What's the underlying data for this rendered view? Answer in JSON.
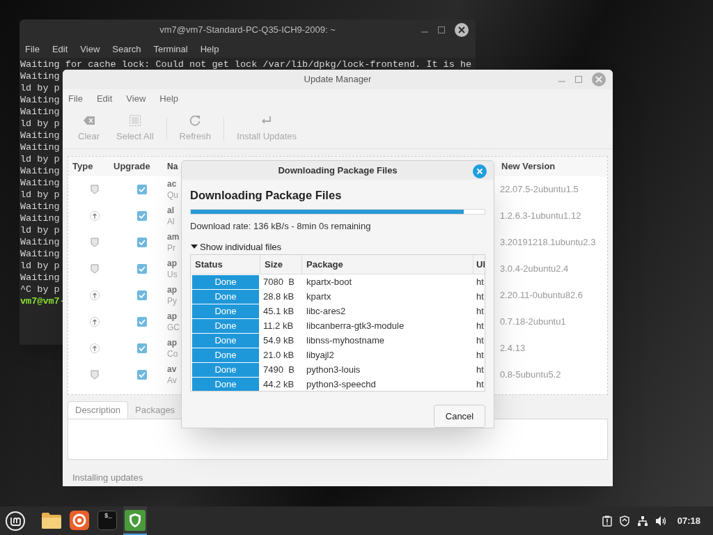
{
  "terminal": {
    "title": "vm7@vm7-Standard-PC-Q35-ICH9-2009: ~",
    "menu": [
      "File",
      "Edit",
      "View",
      "Search",
      "Terminal",
      "Help"
    ],
    "lines": [
      {
        "kind": "output",
        "text": "Waiting for cache lock: Could not get lock /var/lib/dpkg/lock-frontend. It is he"
      },
      {
        "kind": "output",
        "text": "Waiting"
      },
      {
        "kind": "output",
        "text": "ld by p"
      },
      {
        "kind": "output",
        "text": "Waiting"
      },
      {
        "kind": "output",
        "text": "Waiting"
      },
      {
        "kind": "output",
        "text": "ld by p"
      },
      {
        "kind": "output",
        "text": "Waiting"
      },
      {
        "kind": "output",
        "text": "Waiting"
      },
      {
        "kind": "output",
        "text": "ld by p"
      },
      {
        "kind": "output",
        "text": "Waiting"
      },
      {
        "kind": "output",
        "text": "Waiting"
      },
      {
        "kind": "output",
        "text": "ld by p"
      },
      {
        "kind": "output",
        "text": "Waiting"
      },
      {
        "kind": "output",
        "text": "Waiting"
      },
      {
        "kind": "output",
        "text": "ld by p"
      },
      {
        "kind": "output",
        "text": "Waiting"
      },
      {
        "kind": "output",
        "text": "Waiting"
      },
      {
        "kind": "output",
        "text": "ld by p"
      },
      {
        "kind": "output",
        "text": "Waiting"
      },
      {
        "kind": "output",
        "text": "^C by p"
      },
      {
        "kind": "prompt",
        "text": "vm7@vm7-"
      }
    ]
  },
  "update_manager": {
    "title": "Update Manager",
    "menu": [
      "File",
      "Edit",
      "View",
      "Help"
    ],
    "toolbar": [
      {
        "kind": "clear",
        "label": "Clear",
        "disabled": true
      },
      {
        "kind": "select",
        "label": "Select All",
        "disabled": true
      },
      {
        "kind": "refresh",
        "label": "Refresh",
        "disabled": true
      },
      {
        "kind": "install",
        "label": "Install Updates",
        "disabled": true
      }
    ],
    "columns": [
      "Type",
      "Upgrade",
      "Na",
      "New Version"
    ],
    "rows": [
      {
        "kind": "security",
        "upgrade": true,
        "name": "ac",
        "description": "Qu",
        "new_version": "22.07.5-2ubuntu1.5"
      },
      {
        "kind": "update",
        "upgrade": true,
        "name": "al",
        "description": "Al",
        "new_version": "1.2.6.3-1ubuntu1.12"
      },
      {
        "kind": "security",
        "upgrade": true,
        "name": "am",
        "description": "Pr",
        "new_version": "3.20191218.1ubuntu2.3"
      },
      {
        "kind": "security",
        "upgrade": true,
        "name": "ap",
        "description": "Us",
        "new_version": "3.0.4-2ubuntu2.4"
      },
      {
        "kind": "update",
        "upgrade": true,
        "name": "ap",
        "description": "Py",
        "new_version": "2.20.11-0ubuntu82.6"
      },
      {
        "kind": "update",
        "upgrade": true,
        "name": "ap",
        "description": "GC",
        "new_version": "0.7.18-2ubuntu1"
      },
      {
        "kind": "update",
        "upgrade": true,
        "name": "ap",
        "description": "Co",
        "new_version": "2.4.13"
      },
      {
        "kind": "security",
        "upgrade": true,
        "name": "av",
        "description": "Av",
        "new_version": "0.8-5ubuntu5.2"
      }
    ],
    "tabs": [
      {
        "label": "Description",
        "selected": true
      },
      {
        "label": "Packages",
        "selected": false
      }
    ],
    "status": "Installing updates"
  },
  "dialog": {
    "title": "Downloading Package Files",
    "heading": "Downloading Package Files",
    "level": 0.93,
    "rate": "Download rate: 136 kB/s - 8min 0s remaining",
    "expander": {
      "label": "Show individual files",
      "expanded": true
    },
    "columns": [
      "Status",
      "Size",
      "Package",
      "Ul"
    ],
    "files": [
      {
        "status": "Done",
        "size": "7080  B",
        "package": "kpartx-boot",
        "url": "ht"
      },
      {
        "status": "Done",
        "size": "28.8 kB",
        "package": "kpartx",
        "url": "ht"
      },
      {
        "status": "Done",
        "size": "45.1 kB",
        "package": "libc-ares2",
        "url": "ht"
      },
      {
        "status": "Done",
        "size": "11.2 kB",
        "package": "libcanberra-gtk3-module",
        "url": "ht"
      },
      {
        "status": "Done",
        "size": "54.9 kB",
        "package": "libnss-myhostname",
        "url": "ht"
      },
      {
        "status": "Done",
        "size": "21.0 kB",
        "package": "libyajl2",
        "url": "ht"
      },
      {
        "status": "Done",
        "size": "7490  B",
        "package": "python3-louis",
        "url": "ht"
      },
      {
        "status": "Done",
        "size": "44.2 kB",
        "package": "python3-speechd",
        "url": "ht"
      }
    ],
    "button": "Cancel"
  },
  "taskbar": {
    "apps": [
      {
        "kind": "files",
        "active": false
      },
      {
        "kind": "browser",
        "active": false
      },
      {
        "kind": "terminal",
        "label": "$_",
        "active": false
      },
      {
        "kind": "updates",
        "active": true
      }
    ],
    "tray": [
      {
        "kind": "notes"
      },
      {
        "kind": "shield"
      },
      {
        "kind": "network"
      },
      {
        "kind": "volume"
      }
    ],
    "clock": "07:18"
  }
}
